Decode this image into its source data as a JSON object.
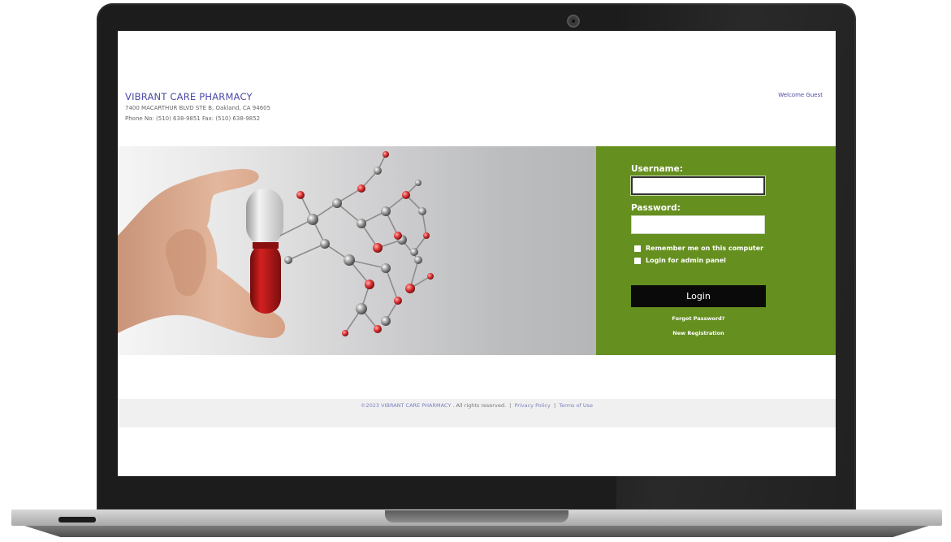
{
  "header": {
    "brand_name": "VIBRANT CARE PHARMACY",
    "address": "7400 MACARTHUR BLVD STE B, Oakland, CA 94605",
    "phone": "Phone No: (510) 638-9851   Fax: (510) 638-9852",
    "welcome": "Welcome Guest"
  },
  "login": {
    "username_label": "Username:",
    "username_value": "",
    "password_label": "Password:",
    "password_value": "",
    "remember_label": "Remember me on this computer",
    "admin_label": "Login for admin panel",
    "login_button": "Login",
    "forgot_password": "Forgot Password?",
    "new_registration": "New Registration"
  },
  "footer": {
    "copyright": "©2023 VIBRANT CARE PHARMACY",
    "rights": ". All rights reserved.",
    "privacy": "Privacy Policy",
    "terms": "Terms of Use"
  },
  "colors": {
    "brand_text": "#4a4aa8",
    "login_panel": "#658f1f",
    "login_button": "#0a0a0a",
    "footer_bg": "#f0f0f0"
  },
  "icons": [
    "webcam-icon",
    "checkbox-icon"
  ]
}
